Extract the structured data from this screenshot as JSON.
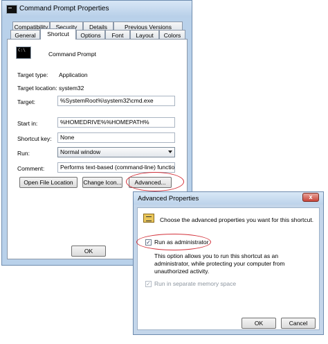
{
  "main_window": {
    "title": "Command Prompt Properties",
    "tabs_row1": [
      "Compatibility",
      "Security",
      "Details",
      "Previous Versions"
    ],
    "tabs_row2": [
      "General",
      "Shortcut",
      "Options",
      "Font",
      "Layout",
      "Colors"
    ],
    "active_tab": "Shortcut",
    "app_name": "Command Prompt",
    "target_type_label": "Target type:",
    "target_type_value": "Application",
    "target_location_label": "Target location:",
    "target_location_value": "system32",
    "target_label": "Target:",
    "target_value": "%SystemRoot%\\system32\\cmd.exe",
    "start_in_label": "Start in:",
    "start_in_value": "%HOMEDRIVE%%HOMEPATH%",
    "shortcut_key_label": "Shortcut key:",
    "shortcut_key_value": "None",
    "run_label": "Run:",
    "run_value": "Normal window",
    "comment_label": "Comment:",
    "comment_value": "Performs text-based (command-line) functions.",
    "buttons": {
      "open_file_location": "Open File Location",
      "change_icon": "Change Icon...",
      "advanced": "Advanced...",
      "ok": "OK"
    }
  },
  "advanced_dialog": {
    "title": "Advanced Properties",
    "close_label": "x",
    "description": "Choose the advanced properties you want for this shortcut.",
    "run_as_admin_label": "Run as administrator",
    "run_as_admin_checked": true,
    "help_text": "This option allows you to run this shortcut as an administrator, while protecting your computer from unauthorized activity.",
    "separate_memory_label": "Run in separate memory space",
    "separate_memory_checked": true,
    "buttons": {
      "ok": "OK",
      "cancel": "Cancel"
    }
  },
  "colors": {
    "highlight_ring": "#d3313a",
    "title_gradient": "#b9d1ea"
  },
  "icons": {
    "title": "cmd-icon",
    "advanced": "shortcut-properties-icon",
    "check": "checkmark"
  }
}
